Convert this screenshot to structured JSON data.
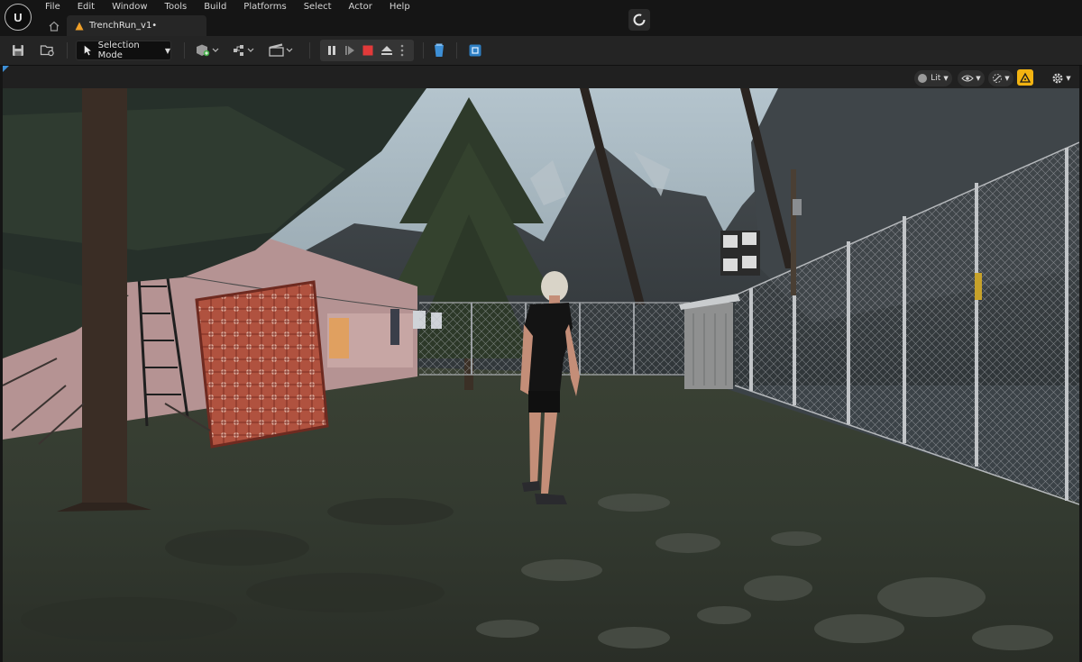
{
  "menu": {
    "items": [
      "File",
      "Edit",
      "Window",
      "Tools",
      "Build",
      "Platforms",
      "Select",
      "Actor",
      "Help"
    ]
  },
  "tab": {
    "title": "TrenchRun_v1•"
  },
  "toolbar": {
    "save_icon": "save-icon",
    "browse_icon": "content-browser-icon",
    "selection_mode_label": "Selection Mode",
    "add_actor_icon": "add-actor-icon",
    "blueprint_icon": "blueprint-icon",
    "cinematics_icon": "cinematics-icon",
    "pause_icon": "pause-icon",
    "frame_skip_icon": "frame-skip-icon",
    "stop_icon": "stop-icon",
    "eject_icon": "eject-icon",
    "platform_icon": "platform-icon",
    "settings_icon": "project-settings-icon",
    "accent_colors": {
      "stop": "#e23a3a",
      "platform": "#3d8fd6",
      "settings": "#2e7fc4"
    }
  },
  "viewport": {
    "lit_label": "Lit",
    "show_icon": "eye-icon",
    "snap_icon": "snap-icon",
    "scalability_icon": "scalability-warning-icon",
    "settings_icon": "gear-icon",
    "scalability_color": "#f2b311"
  }
}
